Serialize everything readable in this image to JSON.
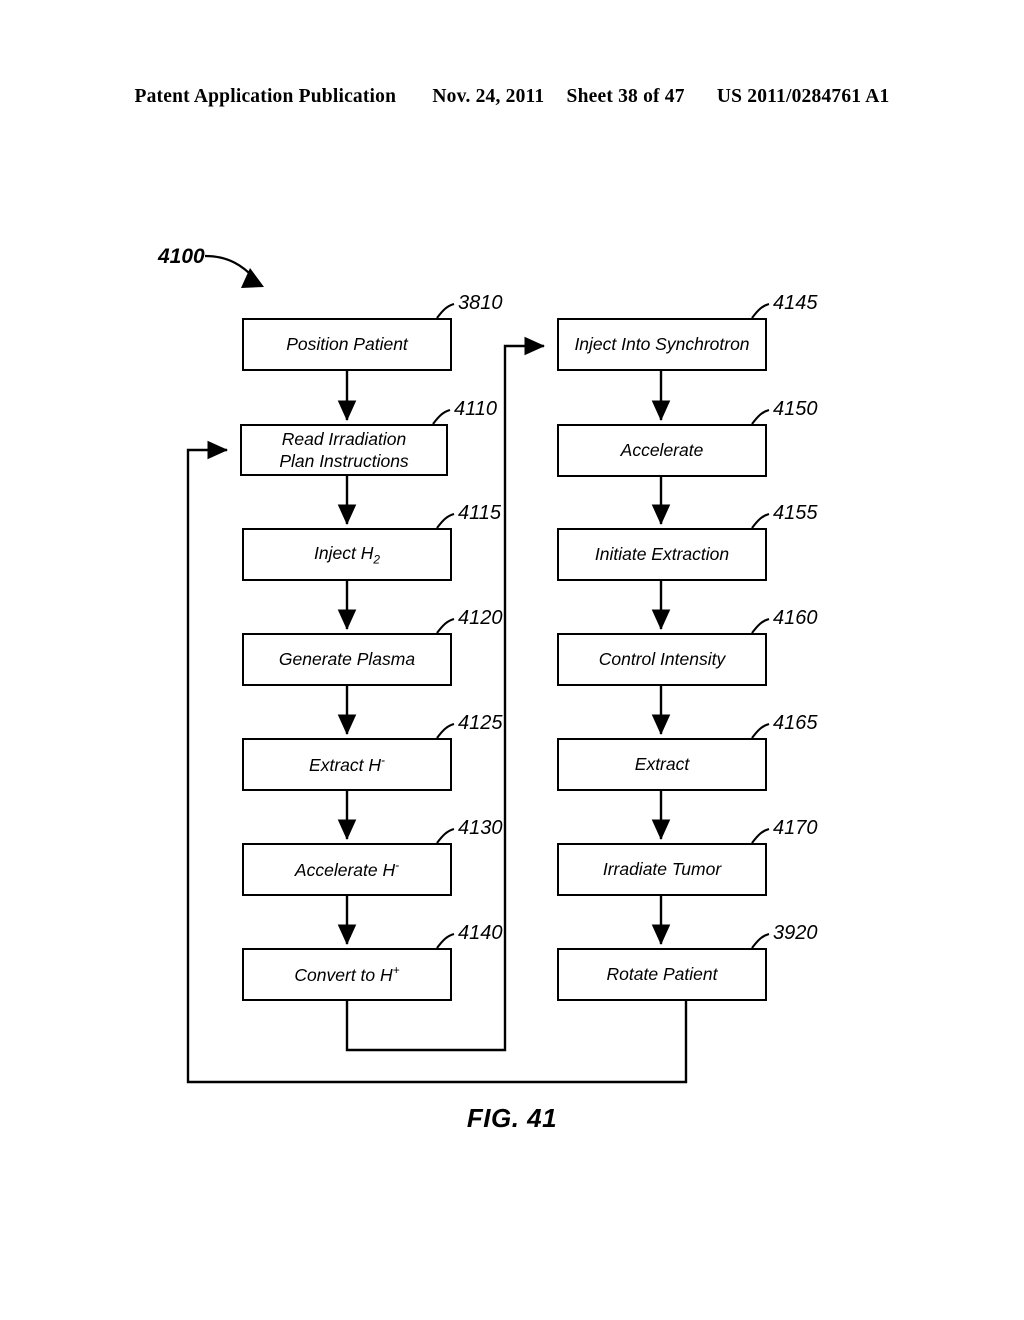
{
  "header": {
    "publication": "Patent Application Publication",
    "date": "Nov. 24, 2011",
    "sheet": "Sheet 38 of 47",
    "number": "US 2011/0284761 A1"
  },
  "figure": {
    "id_label": "4100",
    "caption": "FIG. 41"
  },
  "flowchart": {
    "left_column": [
      {
        "ref": "3810",
        "label": "Position Patient",
        "html": "Position Patient"
      },
      {
        "ref": "4110",
        "label": "Read Irradiation Plan Instructions",
        "html": "Read Irradiation<br>Plan Instructions"
      },
      {
        "ref": "4115",
        "label": "Inject H2",
        "html": "Inject H<sub>2</sub>"
      },
      {
        "ref": "4120",
        "label": "Generate Plasma",
        "html": "Generate Plasma"
      },
      {
        "ref": "4125",
        "label": "Extract H-",
        "html": "Extract H<sup>-</sup>"
      },
      {
        "ref": "4130",
        "label": "Accelerate H-",
        "html": "Accelerate H<sup>-</sup>"
      },
      {
        "ref": "4140",
        "label": "Convert to H+",
        "html": "Convert to H<sup>+</sup>"
      }
    ],
    "right_column": [
      {
        "ref": "4145",
        "label": "Inject Into Synchrotron",
        "html": "Inject Into Synchrotron"
      },
      {
        "ref": "4150",
        "label": "Accelerate",
        "html": "Accelerate"
      },
      {
        "ref": "4155",
        "label": "Initiate Extraction",
        "html": "Initiate Extraction"
      },
      {
        "ref": "4160",
        "label": "Control Intensity",
        "html": "Control Intensity"
      },
      {
        "ref": "4165",
        "label": "Extract",
        "html": "Extract"
      },
      {
        "ref": "4170",
        "label": "Irradiate Tumor",
        "html": "Irradiate Tumor"
      },
      {
        "ref": "3920",
        "label": "Rotate Patient",
        "html": "Rotate Patient"
      }
    ]
  }
}
